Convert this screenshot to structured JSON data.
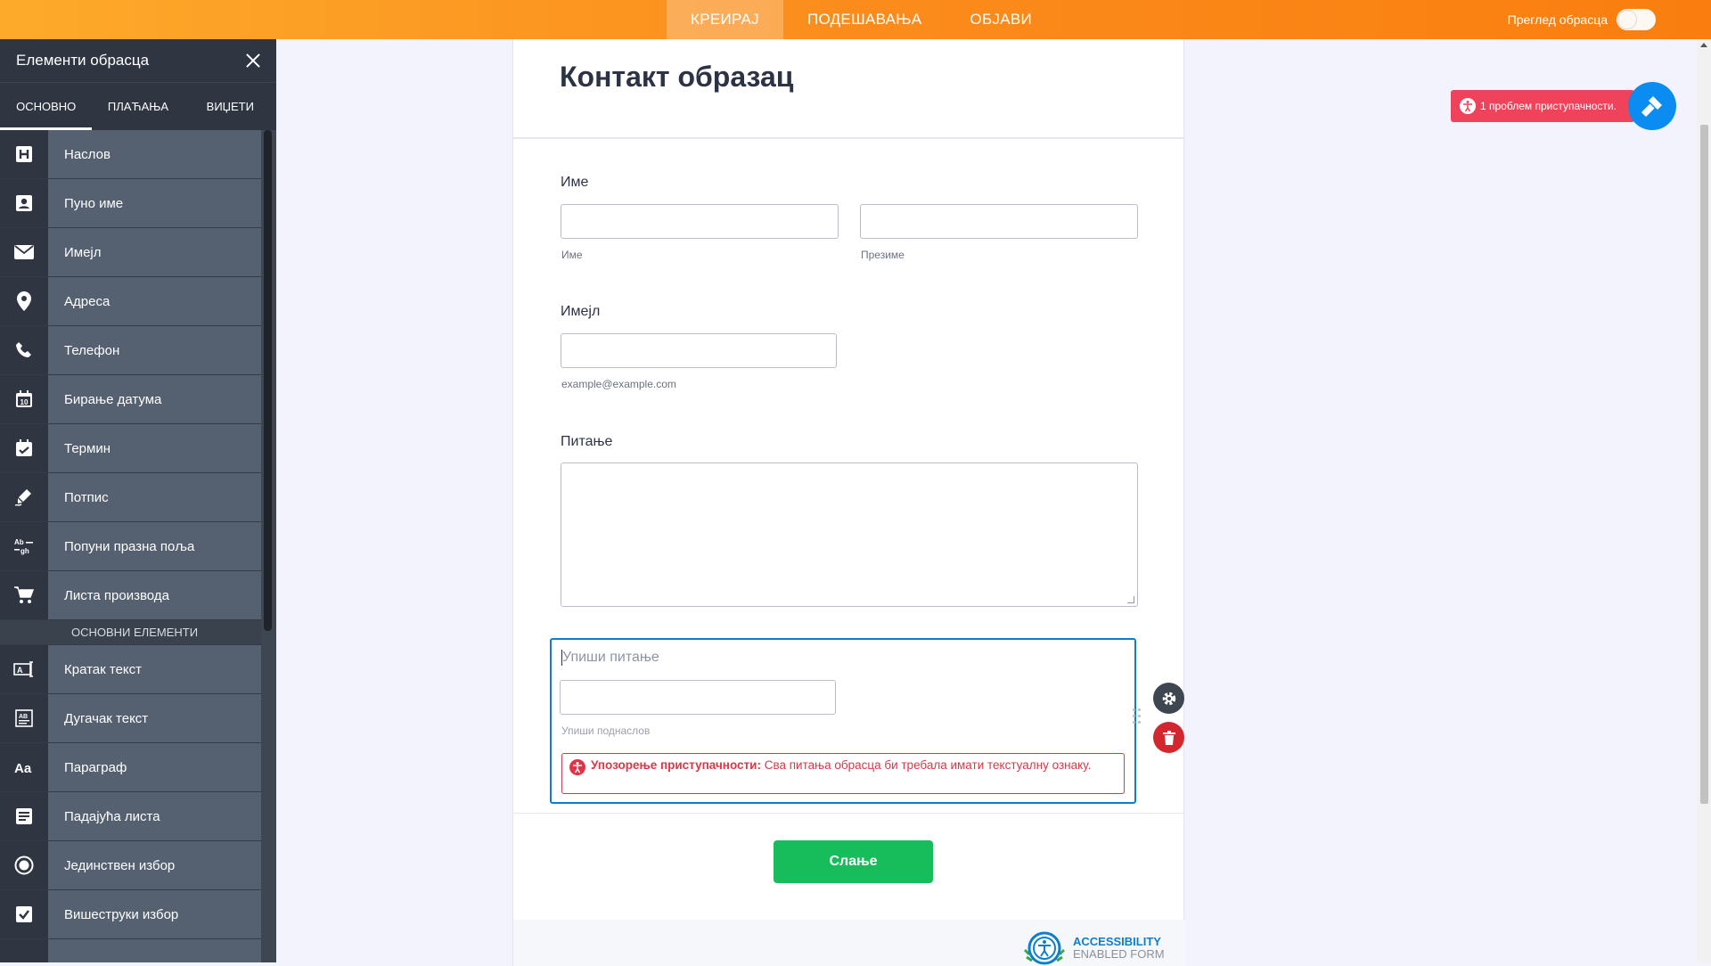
{
  "topbar": {
    "tabs": [
      {
        "label": "КРЕИРАЈ",
        "active": true
      },
      {
        "label": "ПОДЕШАВАЊА",
        "active": false
      },
      {
        "label": "ОБЈАВИ",
        "active": false
      }
    ],
    "preview_label": "Преглед обрасца",
    "preview_on": false
  },
  "sidebar": {
    "title": "Елементи обрасца",
    "tabs": [
      {
        "label": "ОСНОВНО",
        "active": true
      },
      {
        "label": "ПЛАЋАЊА",
        "active": false
      },
      {
        "label": "ВИЏЕТИ",
        "active": false
      }
    ],
    "items": [
      {
        "label": "Наслов",
        "icon": "heading-icon"
      },
      {
        "label": "Пуно име",
        "icon": "person-card-icon"
      },
      {
        "label": "Имејл",
        "icon": "envelope-icon"
      },
      {
        "label": "Адреса",
        "icon": "map-pin-icon"
      },
      {
        "label": "Телефон",
        "icon": "phone-icon"
      },
      {
        "label": "Бирање датума",
        "icon": "calendar-icon"
      },
      {
        "label": "Термин",
        "icon": "calendar-check-icon"
      },
      {
        "label": "Потпис",
        "icon": "pen-icon"
      },
      {
        "label": "Попуни празна поља",
        "icon": "fill-blank-icon"
      },
      {
        "label": "Листа производа",
        "icon": "cart-icon"
      }
    ],
    "section_label": "ОСНОВНИ ЕЛЕМЕНТИ",
    "basic_items": [
      {
        "label": "Кратак текст",
        "icon": "short-text-icon"
      },
      {
        "label": "Дугачак текст",
        "icon": "long-text-icon"
      },
      {
        "label": "Параграф",
        "icon": "paragraph-icon"
      },
      {
        "label": "Падајућа листа",
        "icon": "dropdown-icon"
      },
      {
        "label": "Јединствен избор",
        "icon": "radio-icon"
      },
      {
        "label": "Вишеструки избор",
        "icon": "checkbox-icon"
      }
    ]
  },
  "form": {
    "title": "Контакт образац",
    "name_label": "Име",
    "first_sub": "Име",
    "last_sub": "Презиме",
    "email_label": "Имејл",
    "email_sub": "example@example.com",
    "question_label": "Питање",
    "new_q_placeholder": "Упиши питање",
    "new_q_sub_placeholder": "Упиши поднаслов",
    "warning_bold": "Упозорење приступачности:",
    "warning_text": " Сва питања обрасца би требала имати текстуалну ознаку.",
    "submit_label": "Слање",
    "badge_line1": "ACCESSIBILITY",
    "badge_line2": "ENABLED FORM"
  },
  "accessibility_badge": "1 проблем приступачности.",
  "colors": {
    "topbar": "#fb8c1c",
    "sidebar": "#3e4652",
    "selection": "#0b7fce",
    "warning": "#e13446",
    "submit": "#18bd5b",
    "issue_badge": "#f0425a",
    "wand_button": "#0a8cf0"
  }
}
